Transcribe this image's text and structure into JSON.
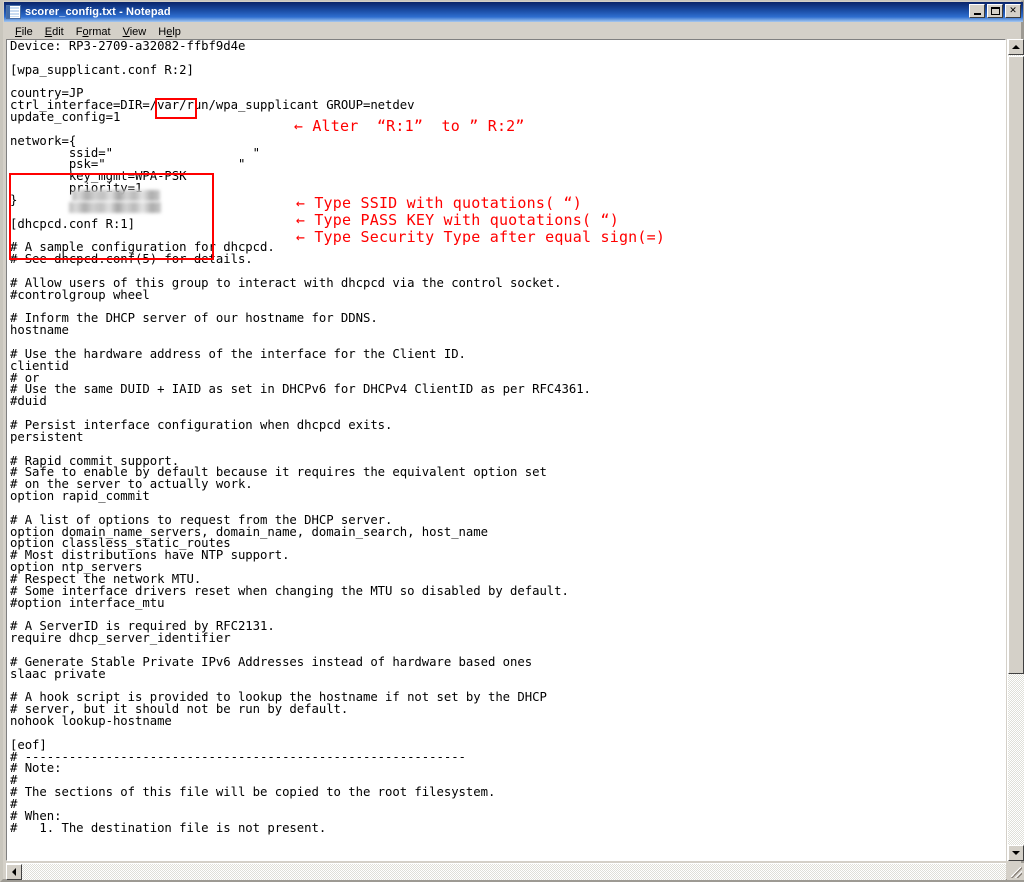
{
  "window": {
    "title": "scorer_config.txt - Notepad",
    "icon": "notepad-document-icon",
    "buttons": {
      "minimize": "Minimize",
      "maximize": "Maximize",
      "close": "Close"
    }
  },
  "menu": {
    "items": [
      {
        "label": "File",
        "accel": "F"
      },
      {
        "label": "Edit",
        "accel": "E"
      },
      {
        "label": "Format",
        "accel": "o"
      },
      {
        "label": "View",
        "accel": "V"
      },
      {
        "label": "Help",
        "accel": "H"
      }
    ]
  },
  "editor": {
    "document_name": "scorer_config.txt",
    "content": "Device: RP3-2709-a32082-ffbf9d4e\n\n[wpa_supplicant.conf R:2]\n\ncountry=JP\nctrl_interface=DIR=/var/run/wpa_supplicant GROUP=netdev\nupdate_config=1\n\nnetwork={\n        ssid=\"                   \"\n        psk=\"                  \"\n        key_mgmt=WPA-PSK\n        priority=1\n}\n\n[dhcpcd.conf R:1]\n\n# A sample configuration for dhcpcd.\n# See dhcpcd.conf(5) for details.\n\n# Allow users of this group to interact with dhcpcd via the control socket.\n#controlgroup wheel\n\n# Inform the DHCP server of our hostname for DDNS.\nhostname\n\n# Use the hardware address of the interface for the Client ID.\nclientid\n# or\n# Use the same DUID + IAID as set in DHCPv6 for DHCPv4 ClientID as per RFC4361.\n#duid\n\n# Persist interface configuration when dhcpcd exits.\npersistent\n\n# Rapid commit support.\n# Safe to enable by default because it requires the equivalent option set\n# on the server to actually work.\noption rapid_commit\n\n# A list of options to request from the DHCP server.\noption domain_name_servers, domain_name, domain_search, host_name\noption classless_static_routes\n# Most distributions have NTP support.\noption ntp_servers\n# Respect the network MTU.\n# Some interface drivers reset when changing the MTU so disabled by default.\n#option interface_mtu\n\n# A ServerID is required by RFC2131.\nrequire dhcp_server_identifier\n\n# Generate Stable Private IPv6 Addresses instead of hardware based ones\nslaac private\n\n# A hook script is provided to lookup the hostname if not set by the DHCP\n# server, but it should not be run by default.\nnohook lookup-hostname\n\n[eof]\n# ------------------------------------------------------------\n# Note:\n#\n# The sections of this file will be copied to the root filesystem.\n#\n# When:\n#   1. The destination file is not present.",
    "redacted_fields": {
      "ssid_value": "",
      "psk_value": ""
    }
  },
  "annotations": {
    "color": "#ff0000",
    "highlight_boxes": [
      {
        "name": "revision-tag-box",
        "label": "R:2]"
      },
      {
        "name": "network-block-box",
        "label": "network={ ... }"
      }
    ],
    "notes": [
      {
        "arrow": "←",
        "text": "Alter  “R:1”  to ” R:2”"
      },
      {
        "arrow": "←",
        "text": "Type SSID with quotations( “)"
      },
      {
        "arrow": "←",
        "text": "Type PASS KEY with quotations( “)"
      },
      {
        "arrow": "←",
        "text": "Type Security Type after equal sign(=)"
      }
    ]
  },
  "scrollbars": {
    "vertical": {
      "up_arrow": "▲",
      "down_arrow": "▼",
      "thumb_position": "top"
    },
    "horizontal": {
      "left_arrow": "◄",
      "right_arrow": "►",
      "thumb_position": "full"
    }
  }
}
